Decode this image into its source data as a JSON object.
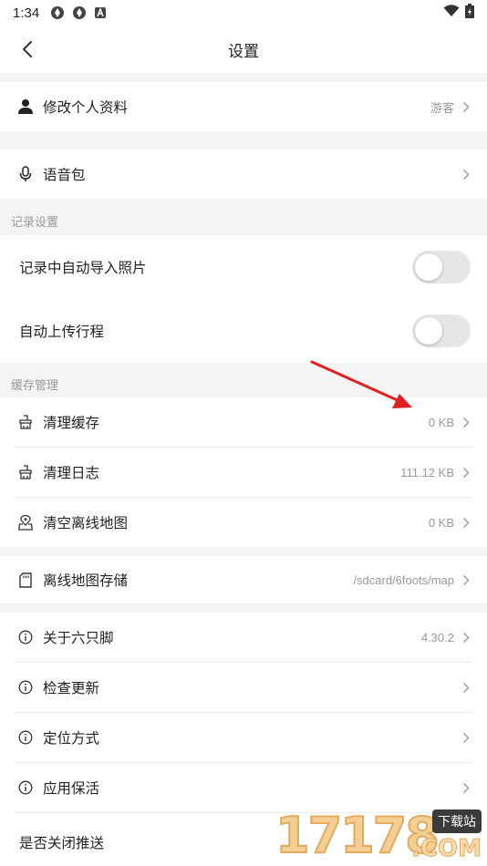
{
  "status_bar": {
    "time": "1:34"
  },
  "header": {
    "title": "设置"
  },
  "profile": {
    "label": "修改个人资料",
    "value": "游客"
  },
  "voice": {
    "label": "语音包"
  },
  "record_section": {
    "title": "记录设置",
    "items": [
      {
        "label": "记录中自动导入照片",
        "enabled": false
      },
      {
        "label": "自动上传行程",
        "enabled": false
      }
    ]
  },
  "cache_section": {
    "title": "缓存管理",
    "items": [
      {
        "label": "清理缓存",
        "value": "0 KB",
        "icon": "broom-icon"
      },
      {
        "label": "清理日志",
        "value": "111.12 KB",
        "icon": "broom-icon"
      },
      {
        "label": "清空离线地图",
        "value": "0 KB",
        "icon": "map-pin-icon"
      }
    ]
  },
  "storage": {
    "label": "离线地图存储",
    "value": "/sdcard/6foots/map"
  },
  "about_section": {
    "items": [
      {
        "label": "关于六只脚",
        "value": "4.30.2"
      },
      {
        "label": "检查更新",
        "value": ""
      },
      {
        "label": "定位方式",
        "value": ""
      },
      {
        "label": "应用保活",
        "value": ""
      }
    ]
  },
  "push": {
    "label": "是否关闭推送"
  },
  "watermark": {
    "number": "17178",
    "suffix": ".COM",
    "badge": "下载站"
  },
  "colors": {
    "annotation_arrow": "#e02020",
    "toggle_off": "#e6e6e6"
  }
}
